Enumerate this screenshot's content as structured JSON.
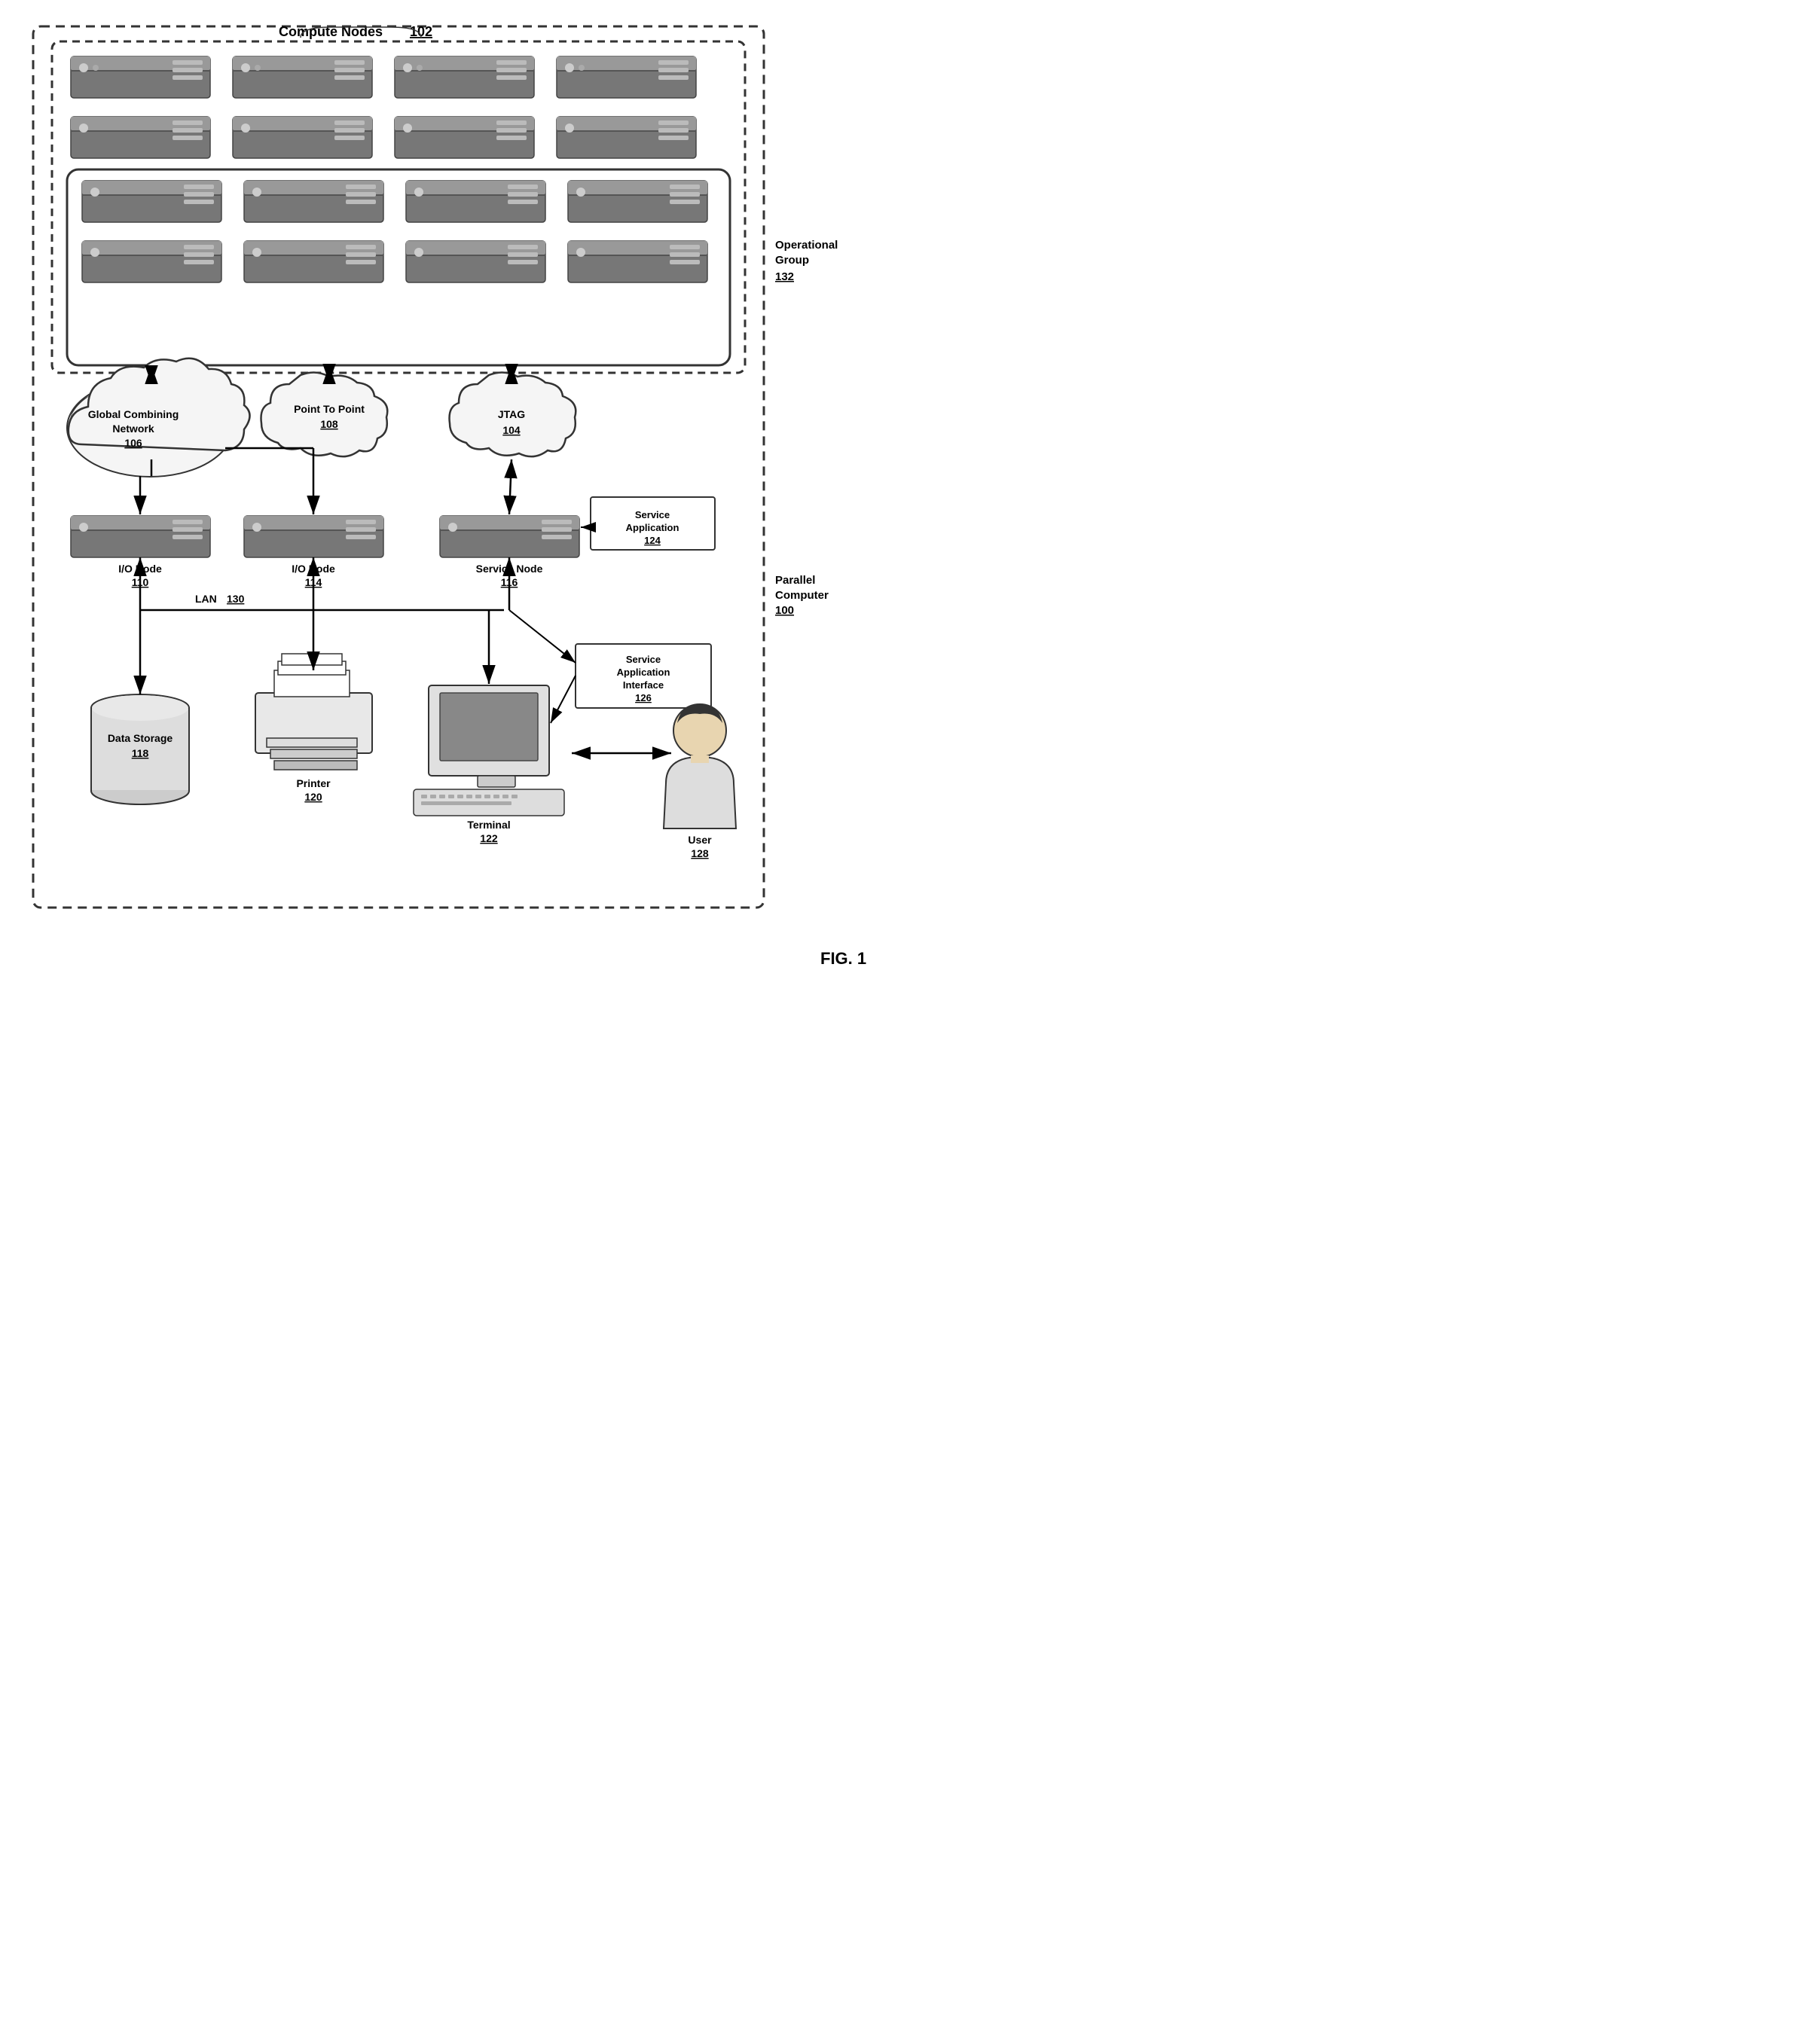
{
  "title": "FIG. 1",
  "labels": {
    "compute_nodes": "Compute Nodes",
    "compute_nodes_num": "102",
    "operational_group": "Operational\nGroup",
    "operational_group_num": "132",
    "parallel_computer": "Parallel\nComputer",
    "parallel_computer_num": "100",
    "gcn": "Global Combining\nNetwork",
    "gcn_num": "106",
    "ptp": "Point To Point",
    "ptp_num": "108",
    "jtag": "JTAG",
    "jtag_num": "104",
    "io_node_1": "I/O Node",
    "io_node_1_num": "110",
    "io_node_2": "I/O Node",
    "io_node_2_num": "114",
    "service_node": "Service Node",
    "service_node_num": "116",
    "service_app": "Service\nApplication",
    "service_app_num": "124",
    "service_app_iface": "Service\nApplication\nInterface",
    "service_app_iface_num": "126",
    "lan": "LAN",
    "lan_num": "130",
    "data_storage": "Data Storage",
    "data_storage_num": "118",
    "printer": "Printer",
    "printer_num": "120",
    "terminal": "Terminal",
    "terminal_num": "122",
    "user": "User",
    "user_num": "128",
    "fig": "FIG. 1"
  }
}
